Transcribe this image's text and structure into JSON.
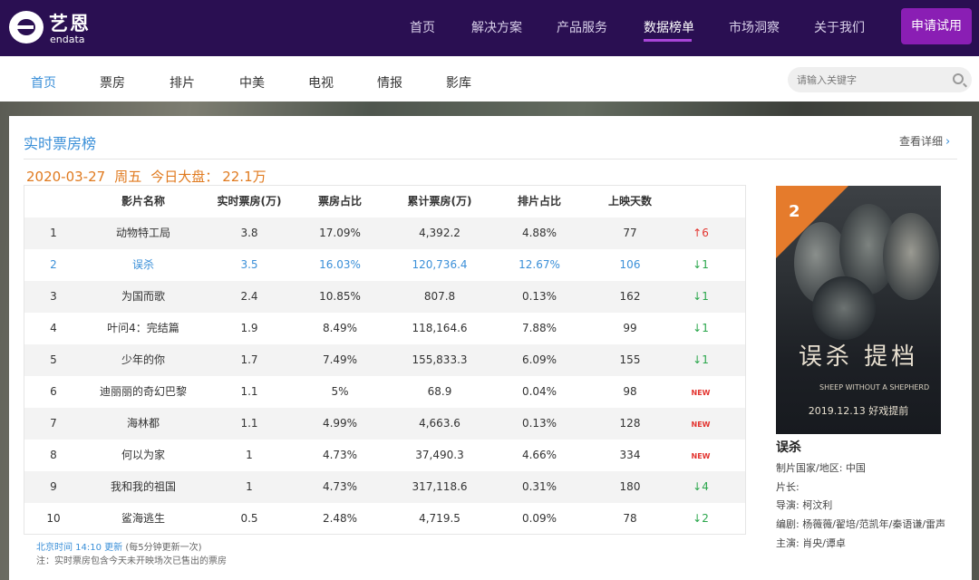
{
  "brand": {
    "cn": "艺恩",
    "en": "endata"
  },
  "topnav": {
    "items": [
      "首页",
      "解决方案",
      "产品服务",
      "数据榜单",
      "市场洞察",
      "关于我们"
    ],
    "active_index": 3,
    "trial_button": "申请试用"
  },
  "subnav": {
    "items": [
      "首页",
      "票房",
      "排片",
      "中美",
      "电视",
      "情报",
      "影库"
    ],
    "active_index": 0,
    "search_placeholder": "请输入关键字"
  },
  "panel": {
    "title": "实时票房榜",
    "view_detail": "查看详细",
    "date": "2020-03-27",
    "weekday": "周五",
    "today_total_label": "今日大盘：",
    "today_total": "22.1万"
  },
  "table": {
    "headers": [
      "",
      "影片名称",
      "实时票房(万)",
      "票房占比",
      "累计票房(万)",
      "排片占比",
      "上映天数",
      ""
    ],
    "rows": [
      {
        "rank": "1",
        "name": "动物特工局",
        "realtime": "3.8",
        "share": "17.09%",
        "total": "4,392.2",
        "schedule": "4.88%",
        "days": "77",
        "trend": "up",
        "trend_value": "6"
      },
      {
        "rank": "2",
        "name": "误杀",
        "realtime": "3.5",
        "share": "16.03%",
        "total": "120,736.4",
        "schedule": "12.67%",
        "days": "106",
        "trend": "down",
        "trend_value": "1"
      },
      {
        "rank": "3",
        "name": "为国而歌",
        "realtime": "2.4",
        "share": "10.85%",
        "total": "807.8",
        "schedule": "0.13%",
        "days": "162",
        "trend": "down",
        "trend_value": "1"
      },
      {
        "rank": "4",
        "name": "叶问4：完结篇",
        "realtime": "1.9",
        "share": "8.49%",
        "total": "118,164.6",
        "schedule": "7.88%",
        "days": "99",
        "trend": "down",
        "trend_value": "1"
      },
      {
        "rank": "5",
        "name": "少年的你",
        "realtime": "1.7",
        "share": "7.49%",
        "total": "155,833.3",
        "schedule": "6.09%",
        "days": "155",
        "trend": "down",
        "trend_value": "1"
      },
      {
        "rank": "6",
        "name": "迪丽丽的奇幻巴黎",
        "realtime": "1.1",
        "share": "5%",
        "total": "68.9",
        "schedule": "0.04%",
        "days": "98",
        "trend": "new",
        "trend_value": "NEW"
      },
      {
        "rank": "7",
        "name": "海林都",
        "realtime": "1.1",
        "share": "4.99%",
        "total": "4,663.6",
        "schedule": "0.13%",
        "days": "128",
        "trend": "new",
        "trend_value": "NEW"
      },
      {
        "rank": "8",
        "name": "何以为家",
        "realtime": "1",
        "share": "4.73%",
        "total": "37,490.3",
        "schedule": "4.66%",
        "days": "334",
        "trend": "new",
        "trend_value": "NEW"
      },
      {
        "rank": "9",
        "name": "我和我的祖国",
        "realtime": "1",
        "share": "4.73%",
        "total": "317,118.6",
        "schedule": "0.31%",
        "days": "180",
        "trend": "down",
        "trend_value": "4"
      },
      {
        "rank": "10",
        "name": "鲨海逃生",
        "realtime": "0.5",
        "share": "2.48%",
        "total": "4,719.5",
        "schedule": "0.09%",
        "days": "78",
        "trend": "down",
        "trend_value": "2"
      }
    ],
    "highlight_index": 1
  },
  "footnote": {
    "updated": "北京时间 14:10 更新",
    "interval": "(每5分钟更新一次)",
    "note": "注：实时票房包含今天未开映场次已售出的票房"
  },
  "feature": {
    "rank_badge": "2",
    "poster_title": "误杀",
    "poster_subtitle": "提档",
    "poster_en": "SHEEP WITHOUT A SHEPHERD",
    "poster_date": "2019.12.13 好戏提前",
    "movie_title": "误杀",
    "country": "制片国家/地区: 中国",
    "length": "片长:",
    "director": "导演: 柯汶利",
    "writers": "编剧: 杨薇薇/翟培/范凯年/秦语谦/雷声",
    "cast": "主演: 肖央/谭卓"
  },
  "colors": {
    "topbar": "#2a0f52",
    "accent_purple": "#8a1eb4",
    "link_blue": "#3a8fd8",
    "date_orange": "#e07a1f",
    "up_red": "#e3342f",
    "down_green": "#2aa64b"
  },
  "icons": {
    "search": "search-icon",
    "chevron": "chevron-right-icon",
    "trend_up": "arrow-up-icon",
    "trend_down": "arrow-down-icon"
  }
}
